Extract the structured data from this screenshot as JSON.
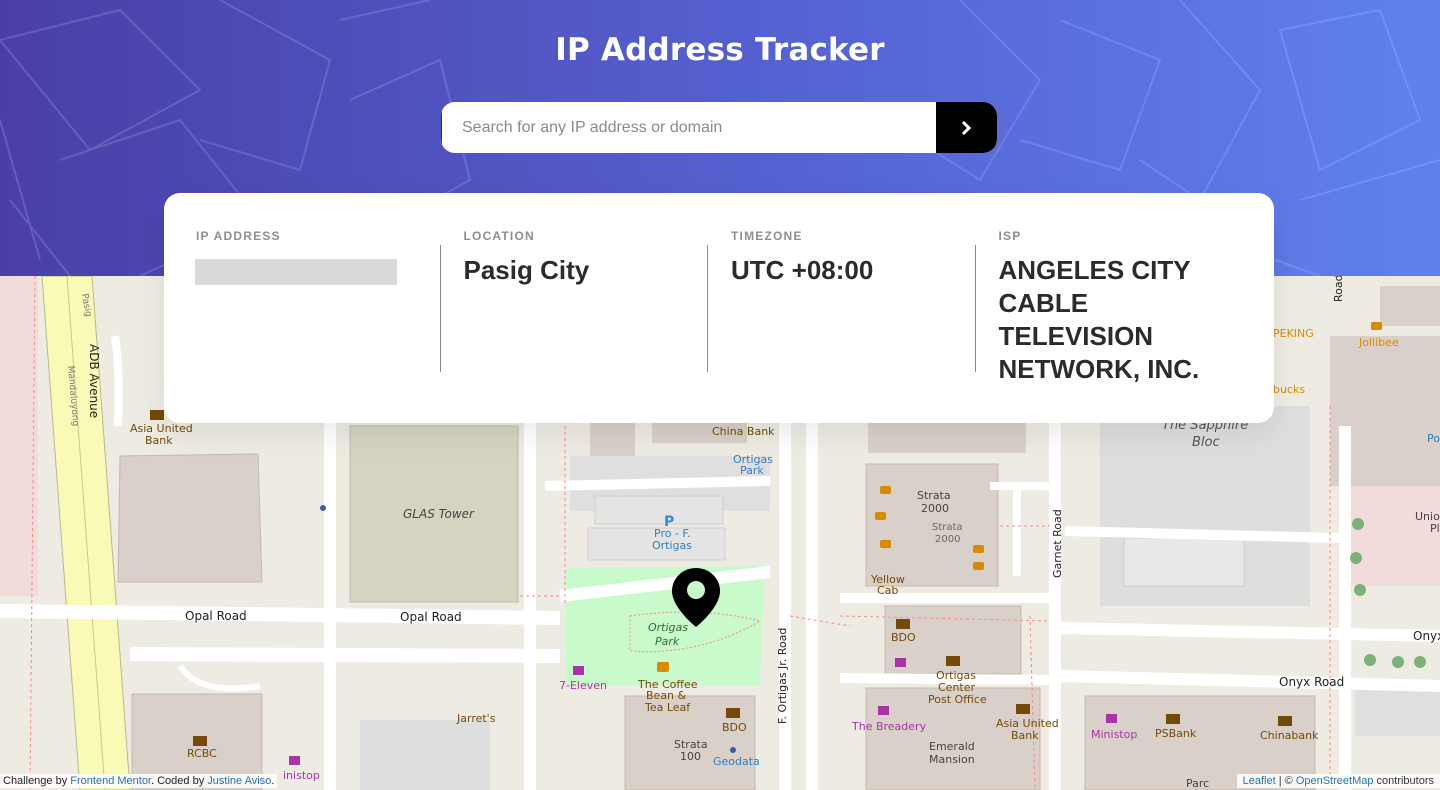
{
  "header": {
    "title": "IP Address Tracker",
    "search_placeholder": "Search for any IP address or domain",
    "submit_icon": "chevron-right-icon"
  },
  "info": {
    "ip_label": "IP ADDRESS",
    "ip_value": "",
    "location_label": "LOCATION",
    "location_value": "Pasig City",
    "timezone_label": "TIMEZONE",
    "timezone_value": "UTC +08:00",
    "isp_label": "ISP",
    "isp_value": "ANGELES CITY CABLE TELEVISION NETWORK, INC."
  },
  "map": {
    "marker_icon": "location-pin-icon",
    "labels": {
      "adb": "ADB Avenue",
      "pasig": "Pasig",
      "mandaluyong": "Mandaluyong",
      "asia_united_1": "Asia United",
      "bank": "Bank",
      "glas": "GLAS Tower",
      "china_bank": "China Bank",
      "ortigas_park_bike": "Ortigas",
      "park": "Park",
      "pro_f": "Pro - F.",
      "ortigas": "Ortigas",
      "parking": "P",
      "opal_road_1": "Opal Road",
      "opal_road_2": "Opal Road",
      "ortigas_park_1": "Ortigas",
      "ortigas_park_2": "Park",
      "seven_eleven": "7-Eleven",
      "coffee_1": "The Coffee",
      "coffee_2": "Bean &",
      "coffee_3": "Tea Leaf",
      "jarrets": "Jarret's",
      "rcbc": "RCBC",
      "ministop_1": "inistop",
      "bdo_1": "BDO",
      "strata100_1": "Strata",
      "strata100_2": "100",
      "geodata": "Geodata",
      "f_ortigas_jr": "F. Ortigas Jr. Road",
      "strata2000_1": "Strata",
      "strata2000_2": "2000",
      "strata2000_3": "Strata",
      "strata2000_4": "2000",
      "yellow_cab_1": "Yellow",
      "yellow_cab_2": "Cab",
      "bdo_2": "BDO",
      "ortigas_center_1": "Ortigas",
      "ortigas_center_2": "Center",
      "ortigas_center_3": "Post Office",
      "breadery": "The Breadery",
      "asia_united_2": "Asia United",
      "bank_2": "Bank",
      "emerald_1": "Emerald",
      "emerald_2": "Mansion",
      "garnet": "Garnet Road",
      "sapphire_1": "The Sapphire",
      "sapphire_2": "Bloc",
      "ministop_2": "Ministop",
      "psbank": "PSBank",
      "chinabank": "Chinabank",
      "onyx_1": "Onyx Road",
      "onyx_2": "Onyx",
      "parc": "Parc",
      "peking": "PEKING",
      "jollibee": "Jollibee",
      "bucks": "bucks",
      "road_top": "Road",
      "unio_1": "Unio",
      "unio_2": "Pl",
      "po": "Po"
    }
  },
  "footer": {
    "challenge_prefix": "Challenge by ",
    "frontend_mentor": "Frontend Mentor",
    "coded_by": ". Coded by ",
    "author": "Justine Aviso",
    "period": ".",
    "leaflet": "Leaflet",
    "attr_sep": " | © ",
    "osm": "OpenStreetMap",
    "contributors": " contributors"
  }
}
